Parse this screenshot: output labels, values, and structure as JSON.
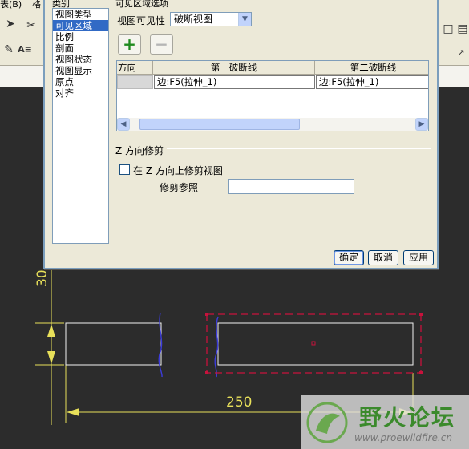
{
  "app": {
    "menu": [
      "表(B)",
      "格"
    ]
  },
  "dialog": {
    "category_legend": "类别",
    "category_items": [
      "视图类型",
      "可见区域",
      "比例",
      "剖面",
      "视图状态",
      "视图显示",
      "原点",
      "对齐"
    ],
    "selected_index": 1,
    "section_legend": "可见区域选项",
    "visibility_label": "视图可见性",
    "visibility_value": "破断视图",
    "add_button": "+",
    "remove_button": "−",
    "table": {
      "headers": [
        "方向",
        "第一破断线",
        "第二破断线"
      ],
      "rows": [
        [
          "",
          "边:F5(拉伸_1)",
          "边:F5(拉伸_1)"
        ]
      ]
    },
    "z_clip_legend": "Z 方向修剪",
    "z_clip_checkbox": "在 Z 方向上修剪视图",
    "clip_ref_label": "修剪参照",
    "clip_ref_value": "",
    "ok_button": "确定",
    "cancel_button": "取消",
    "apply_button": "应用"
  },
  "drawing": {
    "dim_vertical": "30",
    "dim_horizontal": "250"
  },
  "watermark": {
    "title": "野火论坛",
    "url": "www.proewildfire.cn"
  },
  "colors": {
    "accent_green": "#1f8a1f",
    "selection_red": "#c8123c",
    "dimension_yellow": "#e8e05a",
    "break_line_blue": "#3c3cdc"
  }
}
